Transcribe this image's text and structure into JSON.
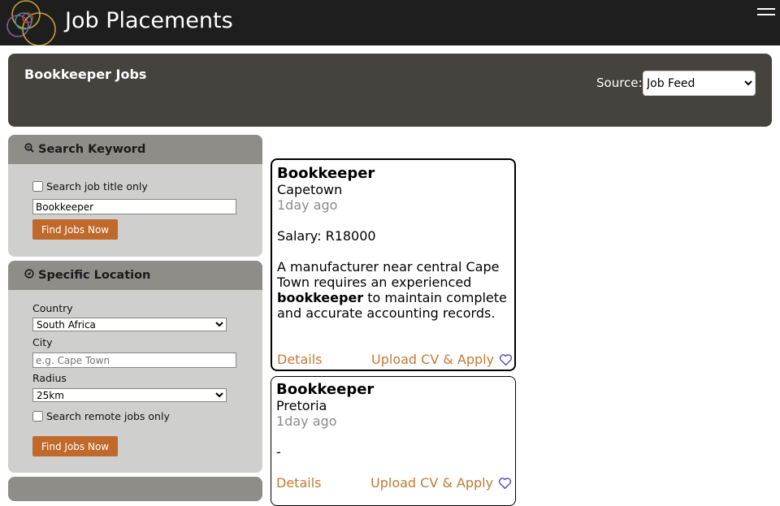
{
  "brand": {
    "name": "Job Placements"
  },
  "nav": {
    "menu_icon": "hamburger-menu-icon"
  },
  "header": {
    "title": "Bookkeeper Jobs",
    "source_label": "Source:",
    "source_value": "Job Feed"
  },
  "search_panel": {
    "title": "Search Keyword",
    "icon": "search-icon",
    "title_only_label": "Search job title only",
    "keyword_value": "Bookkeeper",
    "button_label": "Find Jobs Now"
  },
  "location_panel": {
    "title": "Specific Location",
    "icon": "location-icon",
    "country_label": "Country",
    "country_value": "South Africa",
    "city_label": "City",
    "city_placeholder": "e.g. Cape Town",
    "radius_label": "Radius",
    "radius_value": "25km",
    "remote_label": "Search remote jobs only",
    "button_label": "Find Jobs Now"
  },
  "jobs": [
    {
      "title": "Bookkeeper",
      "location": "Capetown",
      "posted": "1day ago",
      "salary": "Salary: R18000",
      "desc_pre": "A manufacturer near central Cape Town requires an experienced ",
      "desc_bold": "bookkeeper",
      "desc_post": " to maintain complete and accurate accounting records.",
      "details_label": "Details",
      "apply_label": "Upload CV & Apply"
    },
    {
      "title": "Bookkeeper",
      "location": "Pretoria",
      "posted": "1day ago",
      "salary": "-",
      "details_label": "Details",
      "apply_label": "Upload CV & Apply"
    }
  ],
  "colors": {
    "accent": "#c0692a",
    "link": "#c27a35",
    "topbar": "#1e1e1e",
    "header_panel": "#46423e",
    "sidebar_bg": "#cfcfcd",
    "sidebar_head": "#8f8d88"
  }
}
